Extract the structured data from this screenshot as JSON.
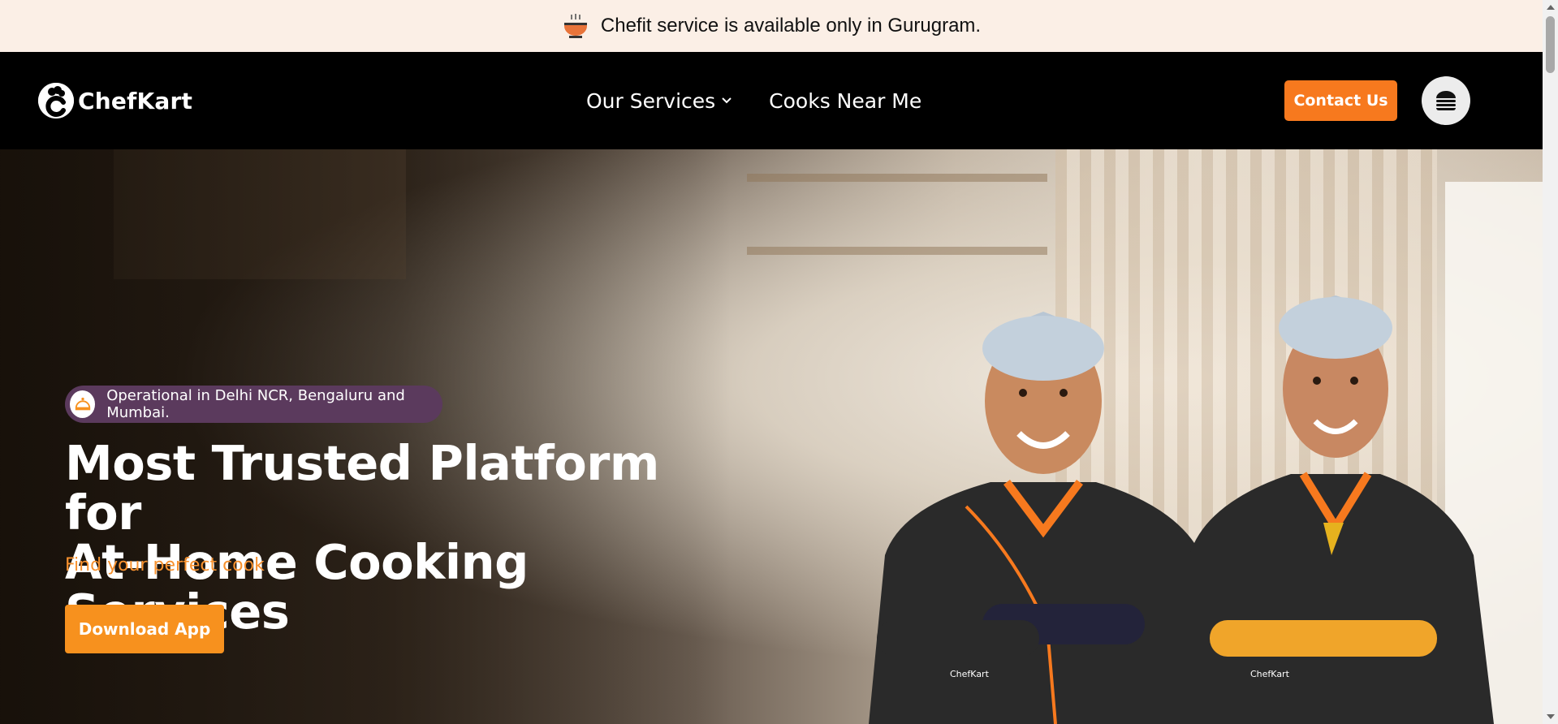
{
  "announcement": {
    "icon": "bowl-icon",
    "text": "Chefit service is available only in Gurugram."
  },
  "header": {
    "logo_text": "ChefKart",
    "nav": [
      {
        "label": "Our Services",
        "has_dropdown": true
      },
      {
        "label": "Cooks Near Me",
        "has_dropdown": false
      }
    ],
    "contact_label": "Contact Us",
    "menu_icon": "burger-icon"
  },
  "hero": {
    "badge_text": "Operational in Delhi NCR, Bengaluru and Mumbai.",
    "title_line1": "Most Trusted Platform for",
    "title_line2": "At-Home Cooking Services",
    "subtitle": "Find your perfect cook",
    "cta_label": "Download App"
  },
  "colors": {
    "accent": "#f7791e",
    "announce_bg": "#fbefe6",
    "header_bg": "#000000",
    "badge_bg": "#5b3a5d"
  }
}
